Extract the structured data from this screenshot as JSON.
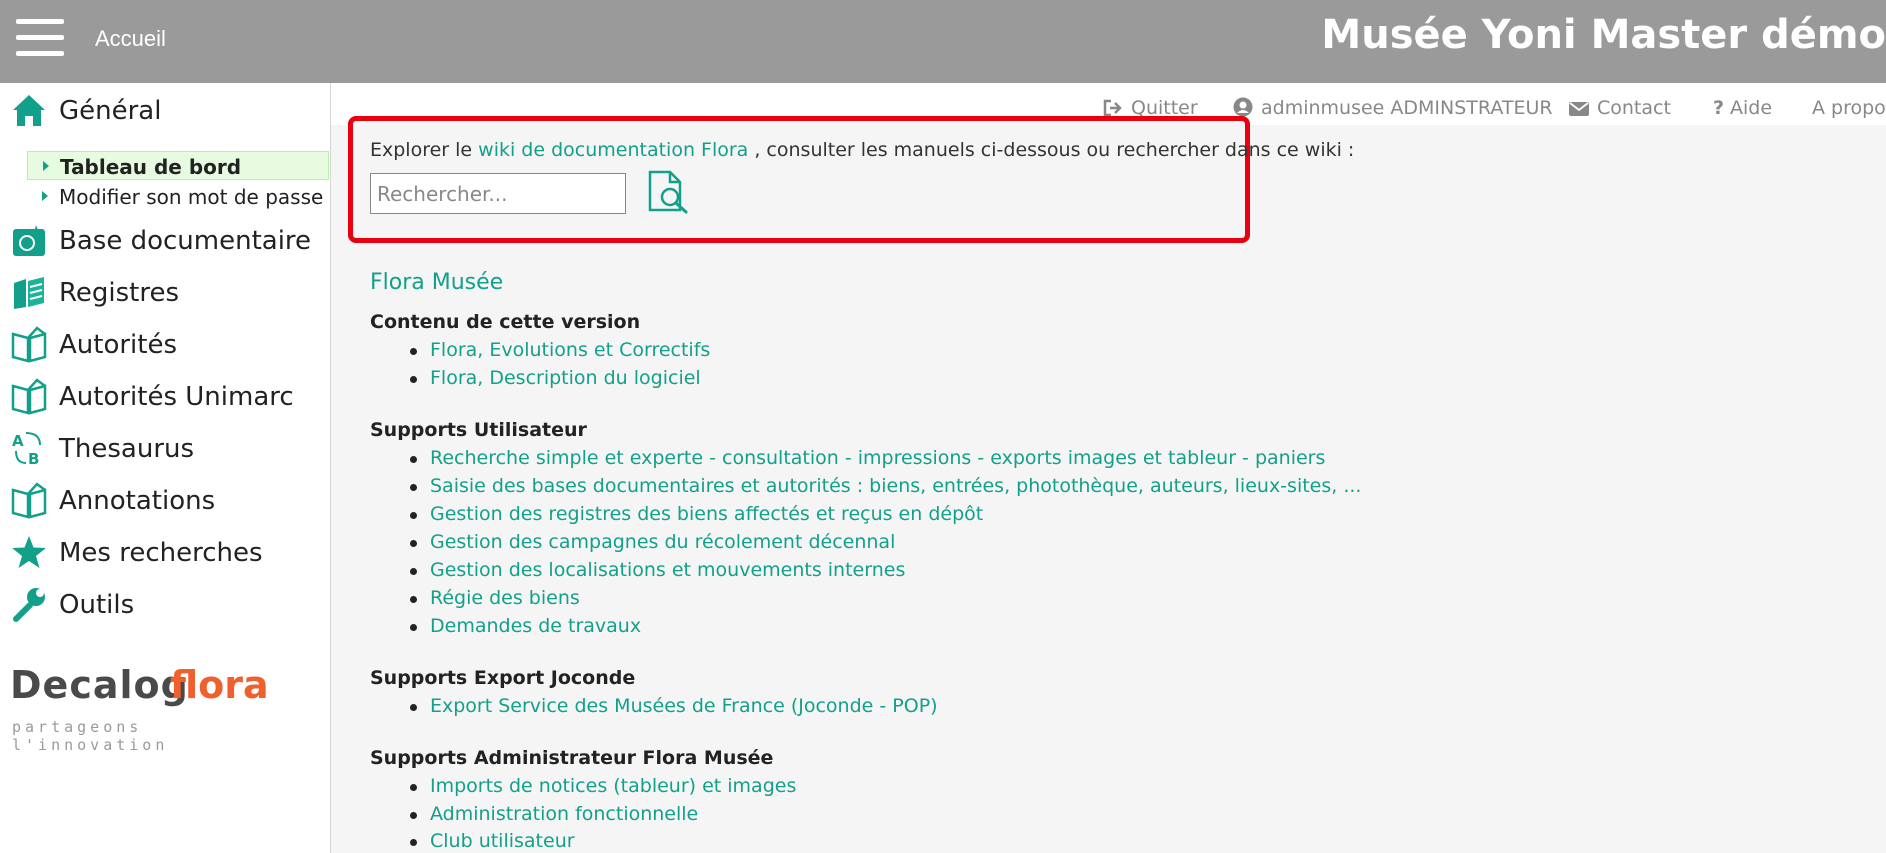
{
  "header": {
    "home_label": "Accueil",
    "app_title": "Musée Yoni Master démo"
  },
  "sidebar": {
    "items": [
      {
        "label": "Général",
        "icon": "home-icon"
      },
      {
        "label": "Base documentaire",
        "icon": "database-icon"
      },
      {
        "label": "Registres",
        "icon": "registers-icon"
      },
      {
        "label": "Autorités",
        "icon": "book-icon"
      },
      {
        "label": "Autorités Unimarc",
        "icon": "book-icon"
      },
      {
        "label": "Thesaurus",
        "icon": "thesaurus-icon"
      },
      {
        "label": "Annotations",
        "icon": "book-icon"
      },
      {
        "label": "Mes recherches",
        "icon": "star-icon"
      },
      {
        "label": "Outils",
        "icon": "wrench-icon"
      }
    ],
    "sub_items": [
      {
        "label": "Tableau de bord",
        "active": true
      },
      {
        "label": "Modifier son mot de passe",
        "active": false
      }
    ],
    "logo": {
      "word1": "Decalog",
      "word2": "flora",
      "tagline": "partageons l'innovation"
    }
  },
  "userbar": {
    "quit_label": "Quitter",
    "user_label": "adminmusee ADMINSTRATEUR",
    "contact_label": "Contact",
    "help_label": "Aide",
    "about_label": "A propos"
  },
  "search": {
    "text_before": "Explorer le ",
    "wiki_link": "wiki de documentation Flora",
    "text_after": " , consulter les manuels ci-dessous ou rechercher dans ce wiki :",
    "placeholder": "Rechercher..."
  },
  "docs": {
    "title": "Flora Musée",
    "groups": [
      {
        "title": "Contenu de cette version",
        "links": [
          "Flora, Evolutions et Correctifs",
          "Flora, Description du logiciel"
        ]
      },
      {
        "title": "Supports Utilisateur",
        "links": [
          "Recherche simple et experte - consultation - impressions - exports images et tableur - paniers",
          "Saisie des bases documentaires et autorités : biens, entrées, photothèque, auteurs, lieux-sites, ...",
          "Gestion des registres des biens affectés et reçus en dépôt",
          "Gestion des campagnes du récolement décennal",
          "Gestion des localisations et mouvements internes",
          "Régie des biens",
          "Demandes de travaux"
        ]
      },
      {
        "title": "Supports Export Joconde",
        "links": [
          "Export Service des Musées de France (Joconde - POP)"
        ]
      },
      {
        "title": "Supports Administrateur Flora Musée",
        "links": [
          "Imports de notices (tableur) et images",
          "Administration fonctionnelle",
          "Club utilisateur"
        ]
      }
    ]
  },
  "colors": {
    "accent": "#13a08a",
    "highlight": "#e8000e",
    "topbar": "#9a9a9a"
  }
}
